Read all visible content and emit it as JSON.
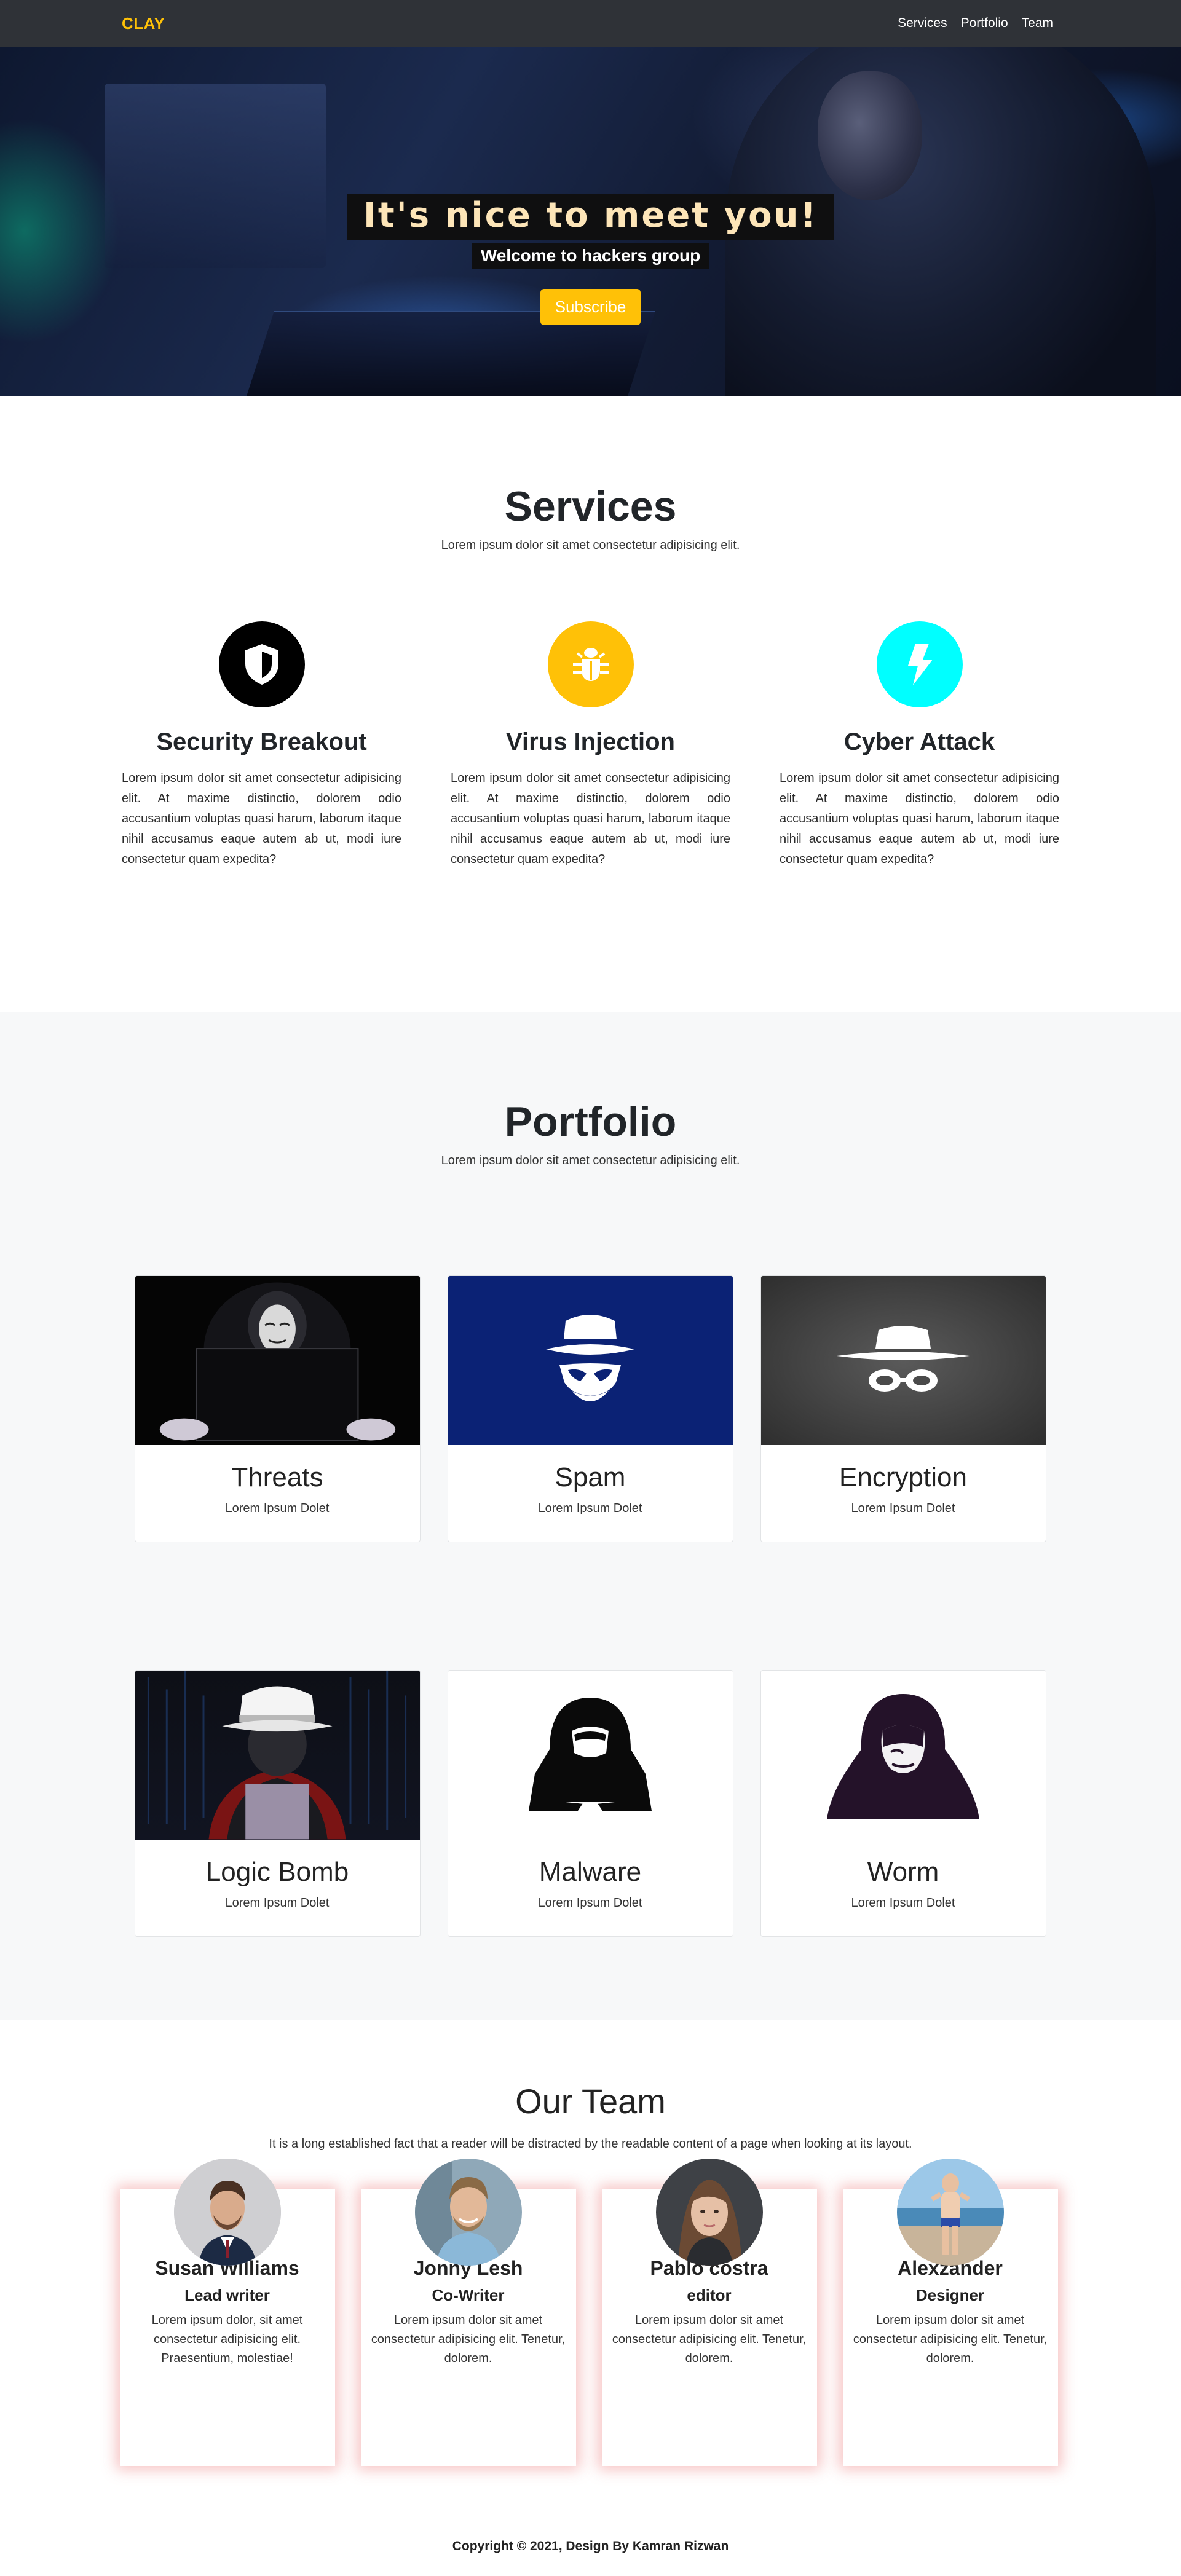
{
  "navbar": {
    "brand": "CLAY",
    "links": [
      "Services",
      "Portfolio",
      "Team"
    ]
  },
  "hero": {
    "title": "It's nice to meet you!",
    "subtitle": "Welcome to hackers group",
    "button": "Subscribe"
  },
  "services": {
    "title": "Services",
    "subtitle": "Lorem ipsum dolor sit amet consectetur adipisicing elit.",
    "items": [
      {
        "title": "Security Breakout",
        "icon": "shield-icon",
        "color": "#000000",
        "text": "Lorem ipsum dolor sit amet consectetur adipisicing elit. At maxime distinctio, dolorem odio accusantium voluptas quasi harum, laborum itaque nihil accusamus eaque autem ab ut, modi iure consectetur quam expedita?"
      },
      {
        "title": "Virus Injection",
        "icon": "bug-icon",
        "color": "#ffc107",
        "text": "Lorem ipsum dolor sit amet consectetur adipisicing elit. At maxime distinctio, dolorem odio accusantium voluptas quasi harum, laborum itaque nihil accusamus eaque autem ab ut, modi iure consectetur quam expedita?"
      },
      {
        "title": "Cyber Attack",
        "icon": "lightning-icon",
        "color": "#00ffff",
        "text": "Lorem ipsum dolor sit amet consectetur adipisicing elit. At maxime distinctio, dolorem odio accusantium voluptas quasi harum, laborum itaque nihil accusamus eaque autem ab ut, modi iure consectetur quam expedita?"
      }
    ]
  },
  "portfolio": {
    "title": "Portfolio",
    "subtitle": "Lorem ipsum dolor sit amet consectetur adipisicing elit.",
    "items": [
      {
        "title": "Threats",
        "subtitle": "Lorem Ipsum Dolet",
        "image": "masked-hacker-laptop-image"
      },
      {
        "title": "Spam",
        "subtitle": "Lorem Ipsum Dolet",
        "image": "spy-hat-icon-blue"
      },
      {
        "title": "Encryption",
        "subtitle": "Lorem Ipsum Dolet",
        "image": "spy-hat-glasses-icon-gray"
      },
      {
        "title": "Logic Bomb",
        "subtitle": "Lorem Ipsum Dolet",
        "image": "white-hat-hacker-image"
      },
      {
        "title": "Malware",
        "subtitle": "Lorem Ipsum Dolet",
        "image": "hooded-hacker-icon"
      },
      {
        "title": "Worm",
        "subtitle": "Lorem Ipsum Dolet",
        "image": "purple-hooded-hacker-icon"
      }
    ]
  },
  "team": {
    "title": "Our Team",
    "subtitle": "It is a long established fact that a reader will be distracted by the readable content of a page when looking at its layout.",
    "members": [
      {
        "name": "Susan Williams",
        "role": "Lead writer",
        "text": "Lorem ipsum dolor, sit amet consectetur adipisicing elit. Praesentium, molestiae!"
      },
      {
        "name": "Jonny Lesh",
        "role": "Co-Writer",
        "text": "Lorem ipsum dolor sit amet consectetur adipisicing elit. Tenetur, dolorem."
      },
      {
        "name": "Pablo costra",
        "role": "editor",
        "text": "Lorem ipsum dolor sit amet consectetur adipisicing elit. Tenetur, dolorem."
      },
      {
        "name": "Alexzander",
        "role": "Designer",
        "text": "Lorem ipsum dolor sit amet consectetur adipisicing elit. Tenetur, dolorem."
      }
    ]
  },
  "footer": {
    "text": "Copyright © 2021, Design By Kamran Rizwan"
  }
}
